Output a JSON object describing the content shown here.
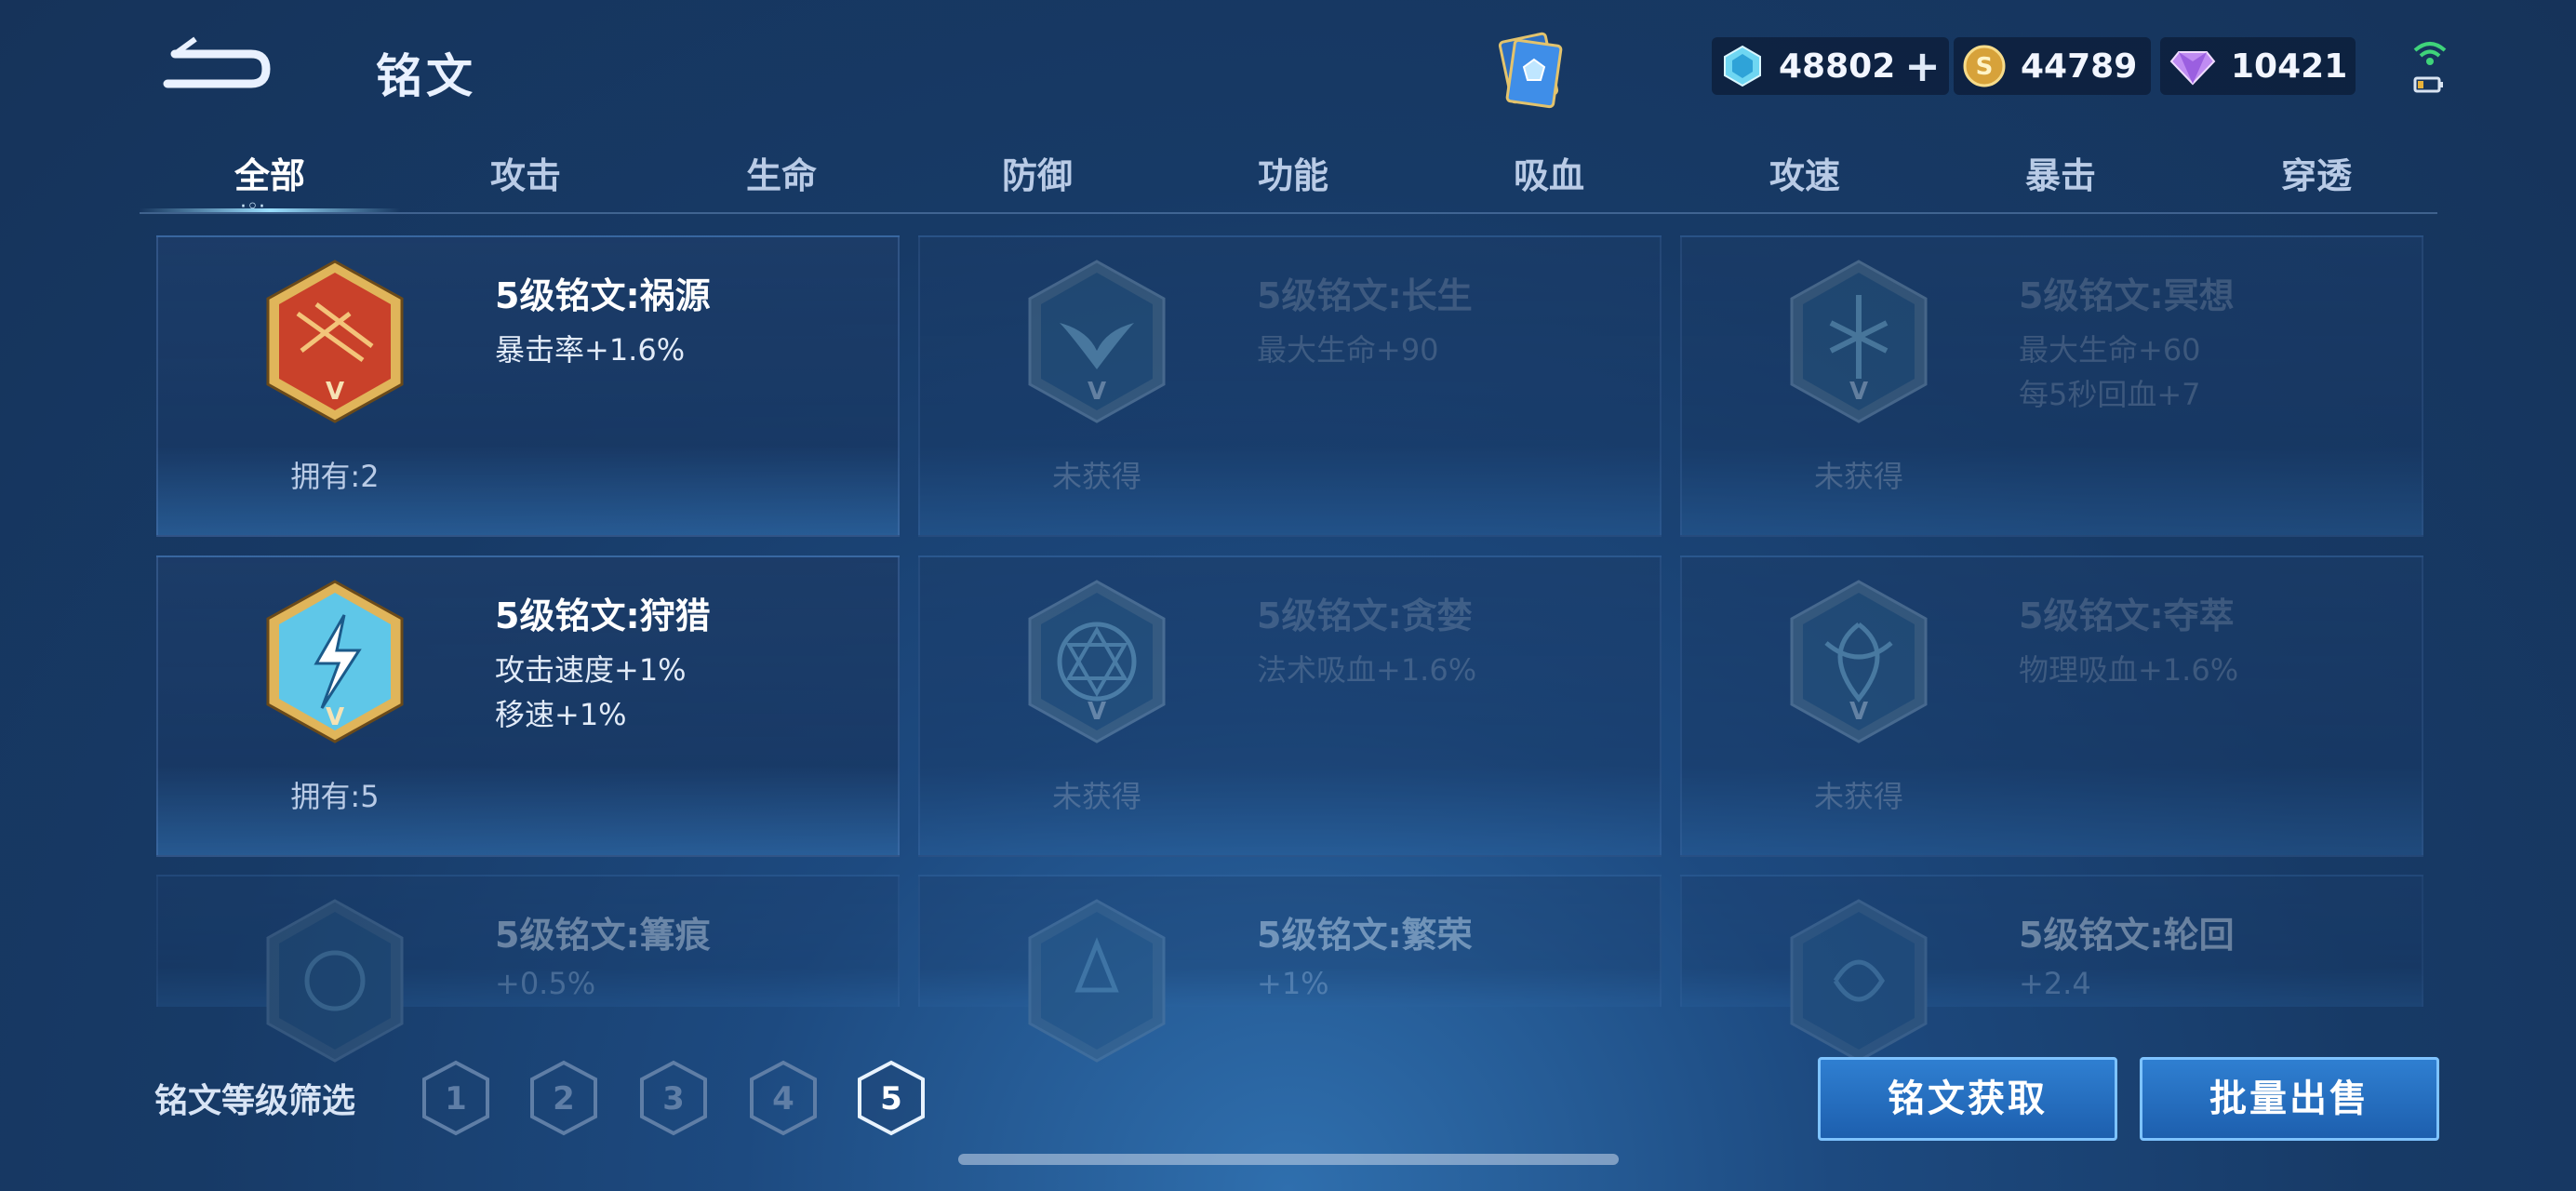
{
  "header": {
    "title": "铭文",
    "back_icon": "back-arrow-icon",
    "deck_icon": "rune-page-icon"
  },
  "currency": {
    "gem": {
      "value": "48802",
      "icon": "blue-crystal-icon"
    },
    "gold": {
      "value": "44789",
      "icon": "gold-coin-icon"
    },
    "diamond": {
      "value": "10421",
      "icon": "purple-diamond-icon"
    }
  },
  "tabs": [
    {
      "label": "全部",
      "active": true
    },
    {
      "label": "攻击"
    },
    {
      "label": "生命"
    },
    {
      "label": "防御"
    },
    {
      "label": "功能"
    },
    {
      "label": "吸血"
    },
    {
      "label": "攻速"
    },
    {
      "label": "暴击"
    },
    {
      "label": "穿透"
    }
  ],
  "runes": [
    {
      "name": "5级铭文:祸源",
      "attrs": [
        "暴击率+1.6%"
      ],
      "owned": "拥有:2",
      "color": "#c9412a"
    },
    {
      "name": "5级铭文:长生",
      "attrs": [
        "最大生命+90"
      ],
      "owned": "未获得",
      "color": "#2b5f8a"
    },
    {
      "name": "5级铭文:冥想",
      "attrs": [
        "最大生命+60",
        "每5秒回血+7"
      ],
      "owned": "未获得",
      "color": "#2b5f8a"
    },
    {
      "name": "5级铭文:狩猎",
      "attrs": [
        "攻击速度+1%",
        "移速+1%"
      ],
      "owned": "拥有:5",
      "color": "#5fc7e8"
    },
    {
      "name": "5级铭文:贪婪",
      "attrs": [
        "法术吸血+1.6%"
      ],
      "owned": "未获得",
      "color": "#2b5f8a"
    },
    {
      "name": "5级铭文:夺萃",
      "attrs": [
        "物理吸血+1.6%"
      ],
      "owned": "未获得",
      "color": "#2b5f8a"
    },
    {
      "name": "5级铭文:篝痕",
      "attrs": [
        "+0.5%"
      ]
    },
    {
      "name": "5级铭文:繁荣",
      "attrs": [
        "+1%"
      ]
    },
    {
      "name": "5级铭文:轮回",
      "attrs": [
        "+2.4"
      ]
    }
  ],
  "emblem_numeral": "V",
  "filter": {
    "label": "铭文等级筛选",
    "levels": [
      "1",
      "2",
      "3",
      "4",
      "5"
    ],
    "selected": "5"
  },
  "buttons": {
    "acquire": "铭文获取",
    "sell": "批量出售"
  }
}
